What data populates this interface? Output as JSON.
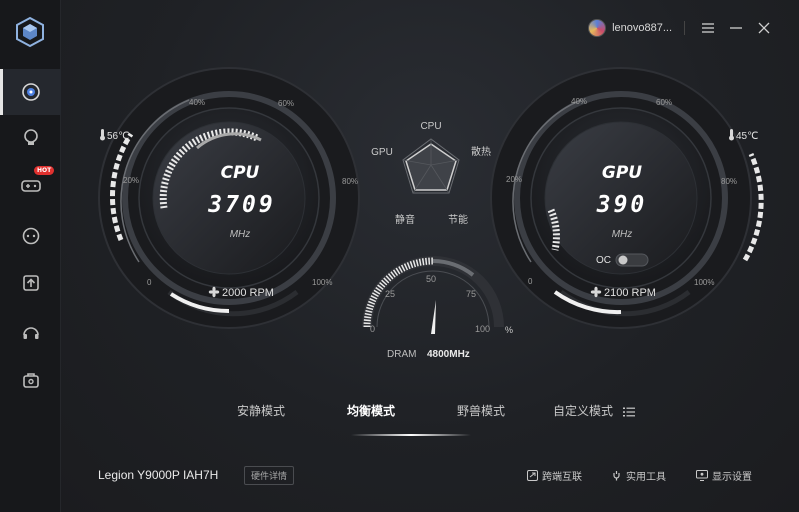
{
  "user": {
    "name": "lenovo887..."
  },
  "sidebar": {
    "items": [
      {
        "icon": "dashboard-icon",
        "active": true
      },
      {
        "icon": "lightbulb-icon"
      },
      {
        "icon": "gamepad-icon",
        "badge": "HOT"
      },
      {
        "icon": "chat-icon"
      },
      {
        "icon": "upload-icon"
      },
      {
        "icon": "headset-icon"
      },
      {
        "icon": "toolbox-icon"
      }
    ]
  },
  "cpu": {
    "label": "CPU",
    "freq": "3709",
    "unit": "MHz",
    "temp": "56℃",
    "fan": "2000 RPM",
    "scale": {
      "p0": "0",
      "p20": "20%",
      "p40": "40%",
      "p60": "60%",
      "p80": "80%",
      "p100": "100%"
    },
    "load_fraction": 0.45
  },
  "gpu": {
    "label": "GPU",
    "freq": "390",
    "unit": "MHz",
    "temp": "45℃",
    "fan": "2100 RPM",
    "oc_label": "OC",
    "oc_enabled": false,
    "scale": {
      "p0": "0",
      "p20": "20%",
      "p40": "40%",
      "p60": "60%",
      "p80": "80%",
      "p100": "100%"
    },
    "load_fraction": 0.12
  },
  "radar": {
    "top": "CPU",
    "left": "GPU",
    "right": "散热",
    "bottom_left": "静音",
    "bottom_right": "节能"
  },
  "dram": {
    "label": "DRAM",
    "freq": "4800MHz",
    "ticks": {
      "t0": "0",
      "t25": "25",
      "t50": "50",
      "t75": "75",
      "t100": "100"
    },
    "unit": "%",
    "value_percent": 50
  },
  "modes": {
    "quiet": "安静模式",
    "balanced": "均衡模式",
    "beast": "野兽模式",
    "custom": "自定义模式"
  },
  "footer": {
    "model": "Legion Y9000P IAH7H",
    "hardware_details": "硬件详情",
    "cross_device": "跨端互联",
    "tools": "实用工具",
    "display_settings": "显示设置"
  },
  "colors": {
    "accent": "#ffffff",
    "background": "#1c1e22",
    "sidebar": "#17181b",
    "hot_badge": "#e0312f"
  }
}
